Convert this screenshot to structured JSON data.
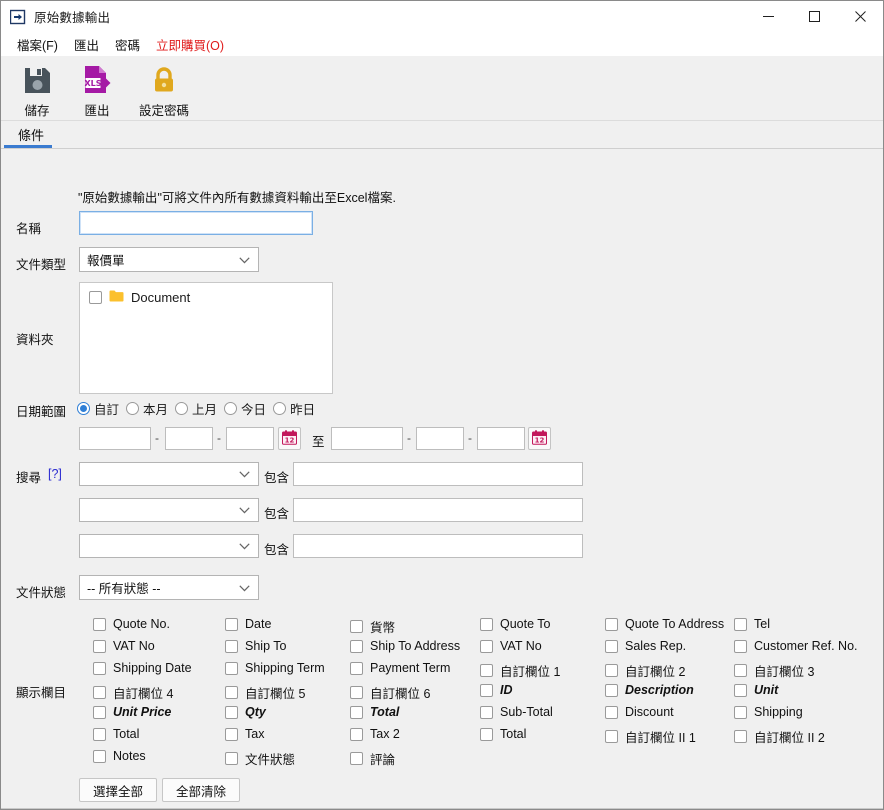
{
  "window": {
    "title": "原始數據輸出",
    "icon": "export-arrow-icon",
    "minimize": "—",
    "maximize": "□",
    "close": "✕"
  },
  "menubar": [
    {
      "name": "menu-file",
      "label": "檔案(F)",
      "accel": "F",
      "accent": false
    },
    {
      "name": "menu-export",
      "label": "匯出",
      "accel": "",
      "accent": false
    },
    {
      "name": "menu-password",
      "label": "密碼",
      "accel": "",
      "accent": false
    },
    {
      "name": "menu-buy-now",
      "label": "立即購買(O)",
      "accel": "O",
      "accent": true
    }
  ],
  "toolbar": [
    {
      "name": "toolbar-save",
      "label": "儲存",
      "icon": "floppy-disk-icon",
      "color": "#48535b"
    },
    {
      "name": "toolbar-export",
      "label": "匯出",
      "icon": "xls-export-icon",
      "color": "#a51aa5"
    },
    {
      "name": "toolbar-set-password",
      "label": "設定密碼",
      "icon": "padlock-icon",
      "color": "#e0a81e"
    }
  ],
  "tabs": [
    {
      "name": "tab-conditions",
      "label": "條件",
      "active": true
    }
  ],
  "form": {
    "description": "\"原始數據輸出\"可將文件內所有數據資料輸出至Excel檔案.",
    "name_label": "名稱",
    "name_value": "",
    "name_placeholder": "",
    "doctype_label": "文件類型",
    "doctype_value": "報價單",
    "folder_label": "資料夾",
    "folder_items": [
      {
        "label": "Document",
        "checked": false,
        "icon": "folder-icon"
      }
    ],
    "daterange_label": "日期範圍",
    "daterange_options": [
      {
        "label": "自訂",
        "selected": true
      },
      {
        "label": "本月",
        "selected": false
      },
      {
        "label": "上月",
        "selected": false
      },
      {
        "label": "今日",
        "selected": false
      },
      {
        "label": "昨日",
        "selected": false
      }
    ],
    "date_from": [
      "",
      "",
      ""
    ],
    "date_to": [
      "",
      "",
      ""
    ],
    "date_separator": "-",
    "date_between_label": "至",
    "calendar_icon": "calendar-icon",
    "search_label": "搜尋",
    "search_help": "[?]",
    "search_rows": [
      {
        "field": "",
        "operator": "包含",
        "value": ""
      },
      {
        "field": "",
        "operator": "包含",
        "value": ""
      },
      {
        "field": "",
        "operator": "包含",
        "value": ""
      }
    ],
    "status_label": "文件狀態",
    "status_value": "-- 所有狀態 --",
    "fields_label": "顯示欄目",
    "select_all_label": "選擇全部",
    "clear_all_label": "全部清除"
  },
  "columns": [
    [
      {
        "label": "Quote No.",
        "checked": false,
        "emphasis": false
      },
      {
        "label": "VAT No",
        "checked": false,
        "emphasis": false
      },
      {
        "label": "Shipping Date",
        "checked": false,
        "emphasis": false
      },
      {
        "label": "自訂欄位 4",
        "checked": false,
        "emphasis": false
      },
      {
        "label": "Unit Price",
        "checked": false,
        "emphasis": true
      },
      {
        "label": "Total",
        "checked": false,
        "emphasis": false
      },
      {
        "label": "Notes",
        "checked": false,
        "emphasis": false
      }
    ],
    [
      {
        "label": "Date",
        "checked": false,
        "emphasis": false
      },
      {
        "label": "Ship To",
        "checked": false,
        "emphasis": false
      },
      {
        "label": "Shipping Term",
        "checked": false,
        "emphasis": false
      },
      {
        "label": "自訂欄位 5",
        "checked": false,
        "emphasis": false
      },
      {
        "label": "Qty",
        "checked": false,
        "emphasis": true
      },
      {
        "label": "Tax",
        "checked": false,
        "emphasis": false
      },
      {
        "label": "文件狀態",
        "checked": false,
        "emphasis": false
      }
    ],
    [
      {
        "label": "貨幣",
        "checked": false,
        "emphasis": false
      },
      {
        "label": "Ship To Address",
        "checked": false,
        "emphasis": false
      },
      {
        "label": "Payment Term",
        "checked": false,
        "emphasis": false
      },
      {
        "label": "自訂欄位 6",
        "checked": false,
        "emphasis": false
      },
      {
        "label": "Total",
        "checked": false,
        "emphasis": true
      },
      {
        "label": "Tax 2",
        "checked": false,
        "emphasis": false
      },
      {
        "label": "評論",
        "checked": false,
        "emphasis": false
      }
    ],
    [
      {
        "label": "Quote To",
        "checked": false,
        "emphasis": false
      },
      {
        "label": "VAT No",
        "checked": false,
        "emphasis": false
      },
      {
        "label": "自訂欄位 1",
        "checked": false,
        "emphasis": false
      },
      {
        "label": "ID",
        "checked": false,
        "emphasis": true
      },
      {
        "label": "Sub-Total",
        "checked": false,
        "emphasis": false
      },
      {
        "label": "Total",
        "checked": false,
        "emphasis": false
      }
    ],
    [
      {
        "label": "Quote To Address",
        "checked": false,
        "emphasis": false
      },
      {
        "label": "Sales Rep.",
        "checked": false,
        "emphasis": false
      },
      {
        "label": "自訂欄位 2",
        "checked": false,
        "emphasis": false
      },
      {
        "label": "Description",
        "checked": false,
        "emphasis": true
      },
      {
        "label": "Discount",
        "checked": false,
        "emphasis": false
      },
      {
        "label": "自訂欄位 II 1",
        "checked": false,
        "emphasis": false
      }
    ],
    [
      {
        "label": "Tel",
        "checked": false,
        "emphasis": false
      },
      {
        "label": "Customer Ref. No.",
        "checked": false,
        "emphasis": false
      },
      {
        "label": "自訂欄位 3",
        "checked": false,
        "emphasis": false
      },
      {
        "label": "Unit",
        "checked": false,
        "emphasis": true
      },
      {
        "label": "Shipping",
        "checked": false,
        "emphasis": false
      },
      {
        "label": "自訂欄位 II 2",
        "checked": false,
        "emphasis": false
      }
    ]
  ],
  "theme": {
    "accent": "#3a7bd0",
    "buy_red": "#e01b1b",
    "window_bg": "#f0f0f0",
    "calendar_pink": "#c2185b",
    "folder_yellow": "#fbc02d"
  }
}
